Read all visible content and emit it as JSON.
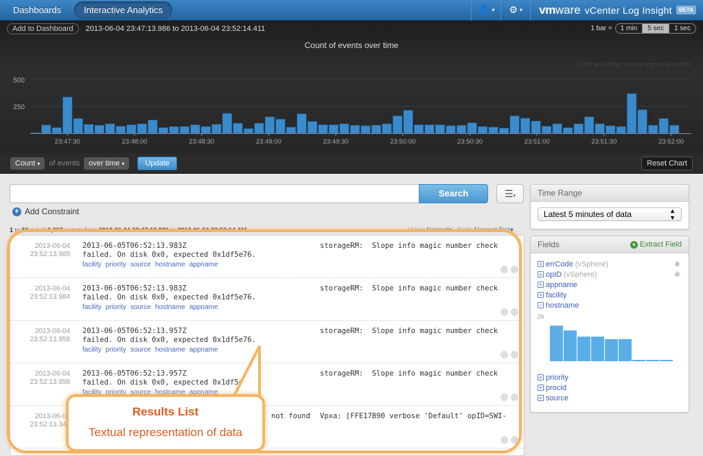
{
  "nav": {
    "tabs": [
      {
        "label": "Dashboards",
        "active": false
      },
      {
        "label": "Interactive Analytics",
        "active": true
      }
    ],
    "user_icon": "user-icon",
    "settings_icon": "gear-icon",
    "brand": {
      "vm": "vm",
      "ware": "ware",
      "product": "vCenter Log Insight",
      "badge": "BETA"
    }
  },
  "chart_header": {
    "add_to_dashboard": "Add to Dashboard",
    "range": "2013-06-04 23:47:13.986 to 2013-06-04 23:52:14.411",
    "bar_label": "1 bar =",
    "bar_options": [
      {
        "label": "1 min",
        "selected": false
      },
      {
        "label": "5 sec",
        "selected": true
      },
      {
        "label": "1 sec",
        "selected": false
      }
    ],
    "hint": "Click and drag over a region to select"
  },
  "chart_data": {
    "type": "bar",
    "title": "Count of events over time",
    "xlabel": "",
    "ylabel": "",
    "ylim": [
      0,
      500
    ],
    "yticks": [
      250,
      500
    ],
    "grid": true,
    "bar_color": "#3a8bcc",
    "xtick_labels": [
      "23:47:30",
      "23:48:00",
      "23:48:30",
      "23:49:00",
      "23:49:30",
      "23:50:00",
      "23:50:30",
      "23:51:00",
      "23:51:30",
      "23:52:00"
    ],
    "values": [
      5,
      77,
      52,
      338,
      137,
      83,
      74,
      88,
      65,
      79,
      88,
      124,
      52,
      62,
      62,
      79,
      62,
      83,
      185,
      93,
      43,
      93,
      153,
      131,
      57,
      181,
      110,
      79,
      79,
      88,
      74,
      70,
      74,
      88,
      162,
      214,
      79,
      79,
      79,
      70,
      74,
      97,
      62,
      57,
      48,
      162,
      140,
      114,
      65,
      88,
      52,
      88,
      153,
      88,
      70,
      62,
      369,
      219,
      74,
      137,
      74
    ]
  },
  "query": {
    "function": "Count",
    "of_events": "of events",
    "grouping": "over time",
    "update": "Update",
    "reset_chart": "Reset Chart"
  },
  "search": {
    "value": "",
    "placeholder": "",
    "button": "Search",
    "menu_icon": "list-menu-icon",
    "add_constraint": "Add Constraint"
  },
  "summary": {
    "from": "1",
    "to_word": "to",
    "to": "50",
    "out_of": "out of",
    "total": "6,267",
    "events_from": "events from",
    "start": "2013-06-04 23:47:13.986",
    "to2": "to",
    "end": "2013-06-04 23:52:14.411",
    "view_label": "View:",
    "view_value": "Normal",
    "sort_label": "Sort:",
    "sort_value": "Newest first"
  },
  "results": [
    {
      "date": "2013-06-04",
      "time": "23:52:13.985",
      "line1": "2013-06-05T06:52:13.983Z",
      "line2": "failed. On disk 0x0, expected 0x1df5e76.",
      "right": "storageRM:  Slope info magic number check",
      "tags": [
        "facility",
        "priority",
        "source",
        "hostname",
        "appname"
      ]
    },
    {
      "date": "2013-06-04",
      "time": "23:52:13.984",
      "line1": "2013-06-05T06:52:13.983Z",
      "line2": "failed. On disk 0x0, expected 0x1df5e76.",
      "right": "storageRM:  Slope info magic number check",
      "tags": [
        "facility",
        "priority",
        "source",
        "hostname",
        "appname"
      ]
    },
    {
      "date": "2013-06-04",
      "time": "23:52:13.958",
      "line1": "2013-06-05T06:52:13.957Z",
      "line2": "failed. On disk 0x0, expected 0x1df5e76.",
      "right": "storageRM:  Slope info magic number check",
      "tags": [
        "facility",
        "priority",
        "source",
        "hostname",
        "appname"
      ]
    },
    {
      "date": "2013-06-04",
      "time": "23:52:13.958",
      "line1": "2013-06-05T06:52:13.957Z",
      "line2": "failed. On disk 0x0, expected 0x1df5e76.",
      "right": "storageRM:  Slope info magic number check",
      "tags": [
        "facility",
        "priority",
        "source",
        "hostname",
        "appname"
      ]
    },
    {
      "date": "2013-06-04",
      "time": "23:52:13.341",
      "line1": "",
      "line2": "not found",
      "right": "Vpxa: [FFE17B90 verbose 'Default' opID=SWI-",
      "tags": []
    }
  ],
  "time_range": {
    "title": "Time Range",
    "selected": "Latest 5 minutes of data"
  },
  "fields": {
    "title": "Fields",
    "extract": "Extract Field",
    "list_top": [
      {
        "name": "errCode",
        "source": "(vSphere)",
        "expanded": false,
        "eye": true
      },
      {
        "name": "opID",
        "source": "(vSphere)",
        "expanded": false,
        "eye": true
      },
      {
        "name": "appname",
        "source": "",
        "expanded": false,
        "eye": false
      },
      {
        "name": "facility",
        "source": "",
        "expanded": false,
        "eye": false
      },
      {
        "name": "hostname",
        "source": "",
        "expanded": true,
        "eye": false
      }
    ],
    "hostname_chart": {
      "ylabel": "2k",
      "ymax": 2000,
      "values": [
        1850,
        1600,
        1280,
        1280,
        1150,
        1150,
        60,
        60,
        60
      ],
      "color": "#5aaee8"
    },
    "list_bottom": [
      {
        "name": "priority",
        "expanded": false
      },
      {
        "name": "procid",
        "expanded": false
      },
      {
        "name": "source",
        "expanded": false
      }
    ]
  },
  "annotation": {
    "title": "Results List",
    "subtitle": "Textual representation of data",
    "color": "#de5c1e"
  }
}
